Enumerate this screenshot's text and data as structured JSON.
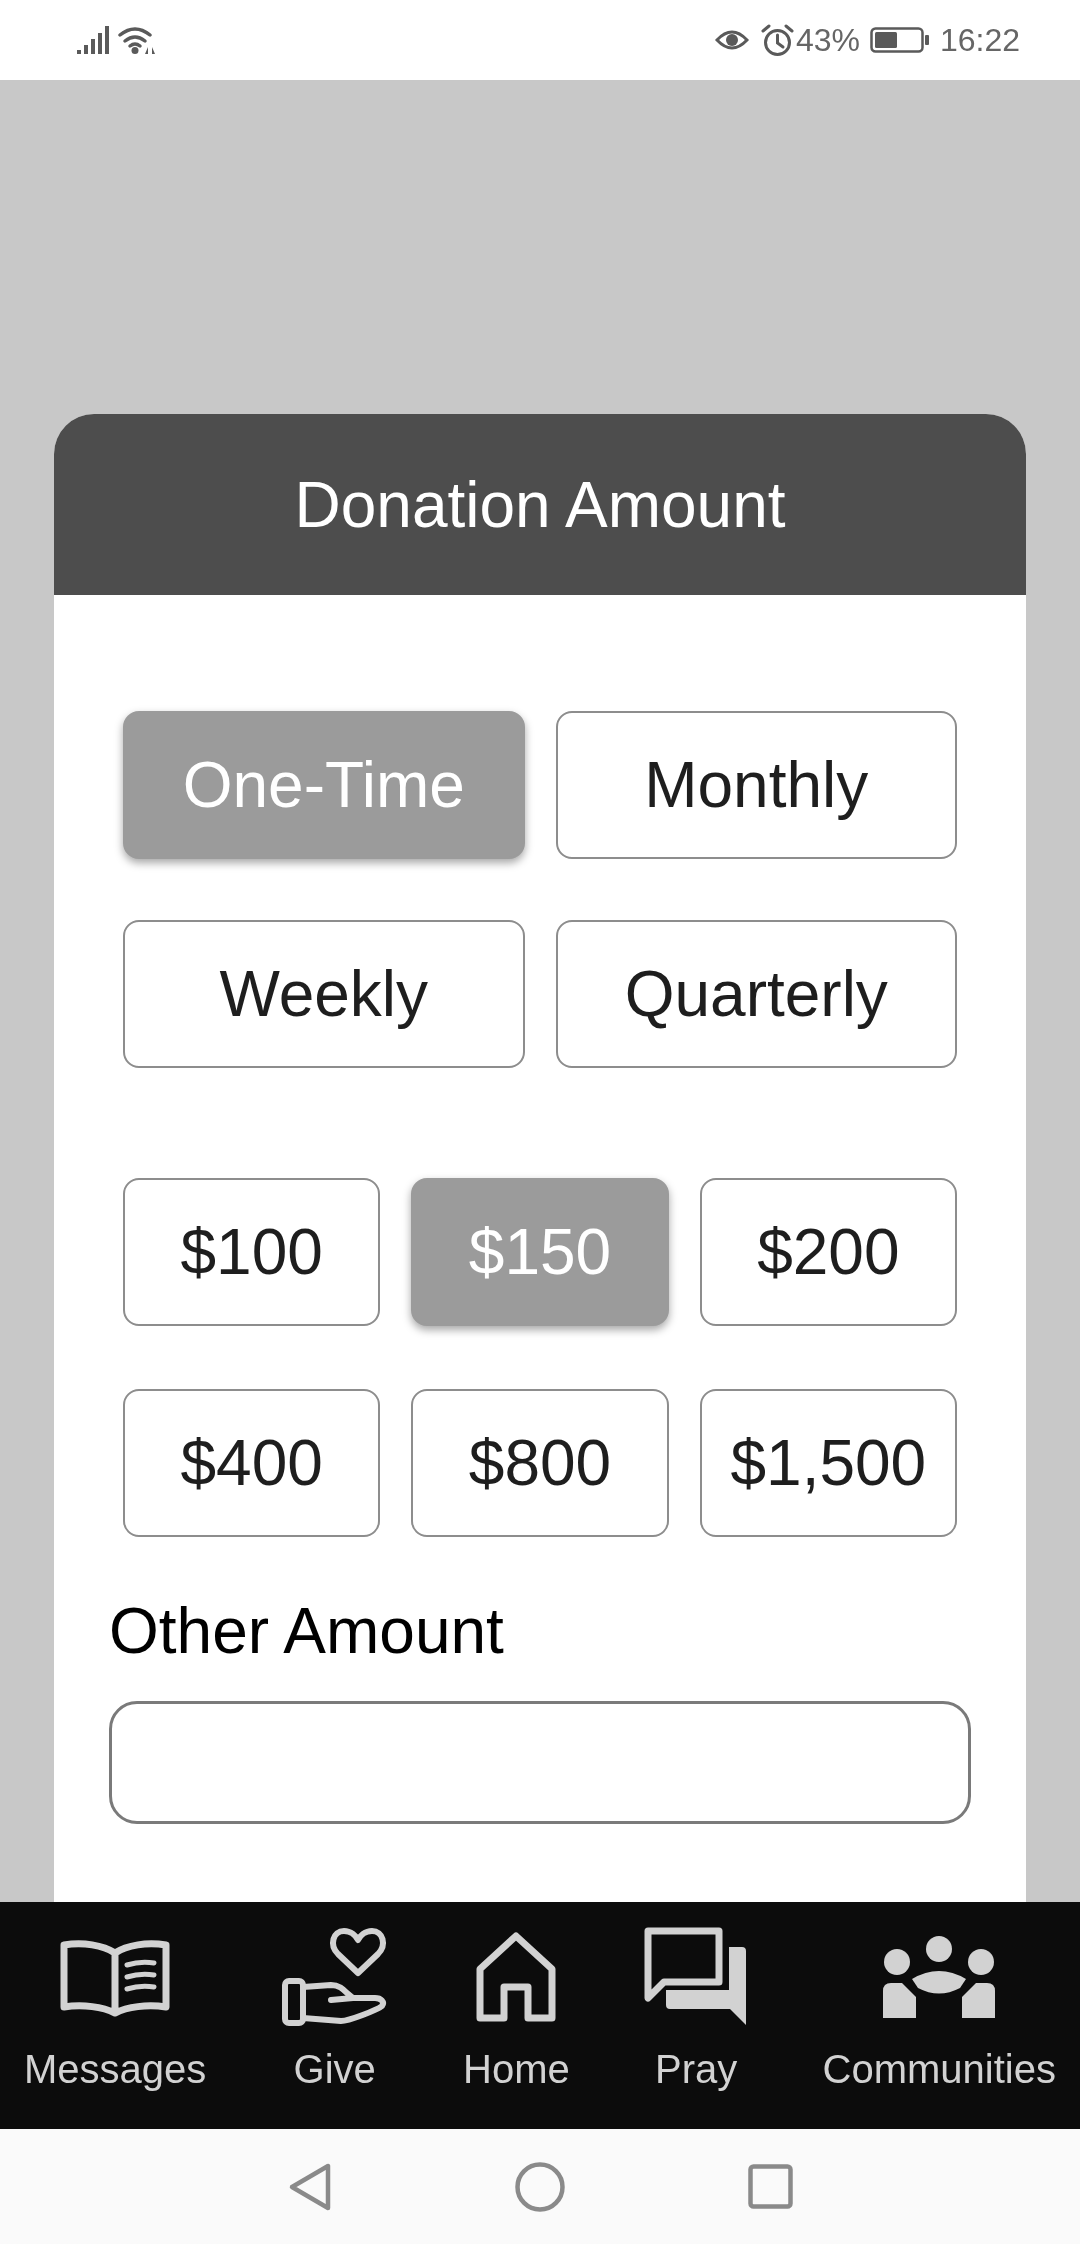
{
  "status_bar": {
    "battery": "43%",
    "time": "16:22"
  },
  "dialog": {
    "title": "Donation Amount",
    "frequencies": [
      {
        "label": "One-Time",
        "selected": true
      },
      {
        "label": "Monthly",
        "selected": false
      },
      {
        "label": "Weekly",
        "selected": false
      },
      {
        "label": "Quarterly",
        "selected": false
      }
    ],
    "amounts": [
      {
        "label": "$100",
        "selected": false
      },
      {
        "label": "$150",
        "selected": true
      },
      {
        "label": "$200",
        "selected": false
      },
      {
        "label": "$400",
        "selected": false
      },
      {
        "label": "$800",
        "selected": false
      },
      {
        "label": "$1,500",
        "selected": false
      }
    ],
    "other_amount": {
      "label": "Other Amount"
    }
  },
  "tab_bar": [
    {
      "label": "Messages",
      "selected": false
    },
    {
      "label": "Give",
      "selected": false
    },
    {
      "label": "Home",
      "selected": false
    },
    {
      "label": "Pray",
      "selected": false
    },
    {
      "label": "Communities",
      "selected": false
    }
  ]
}
